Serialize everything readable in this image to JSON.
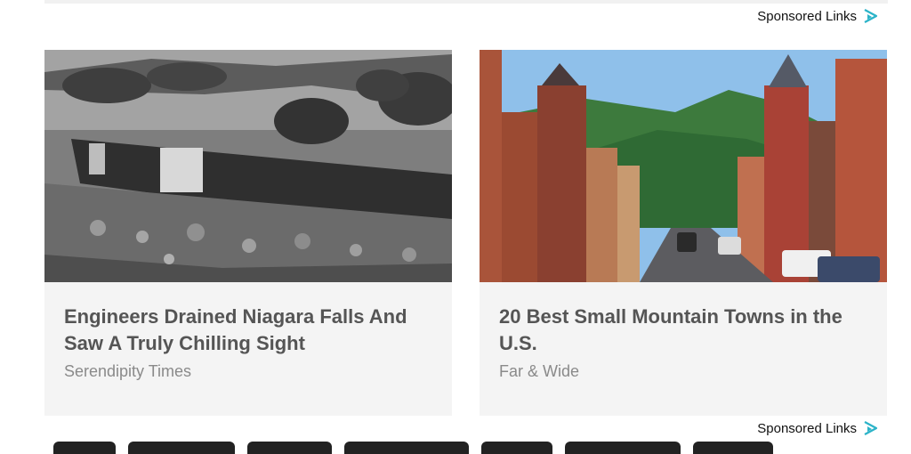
{
  "sponsored": {
    "label": "Sponsored Links",
    "icon": "play-triangle-icon",
    "accent": "#2bb3c8"
  },
  "cards": [
    {
      "title": "Engineers Drained Niagara Falls And Saw A Truly Chilling Sight",
      "source": "Serendipity Times",
      "image": "dry-waterfall-black-and-white-photo"
    },
    {
      "title": "20 Best Small Mountain Towns in the U.S.",
      "source": "Far & Wide",
      "image": "mountain-town-main-street-photo"
    }
  ]
}
